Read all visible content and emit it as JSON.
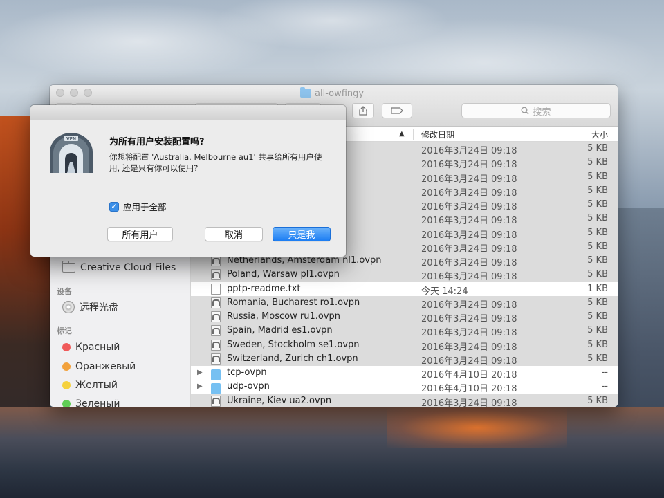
{
  "finder": {
    "title": "all-owfingy",
    "search_placeholder": "搜索",
    "columns": {
      "name": "",
      "date": "修改日期",
      "size": "大小"
    },
    "sidebar": {
      "creative_cloud": "Creative Cloud Files",
      "devices_header": "设备",
      "remote_disc": "远程光盘",
      "tags_header": "标记",
      "tags": [
        {
          "label": "Красный",
          "color": "#f05a5a"
        },
        {
          "label": "Оранжевый",
          "color": "#f2a13c"
        },
        {
          "label": "Желтый",
          "color": "#f5d13d"
        },
        {
          "label": "Зеленый",
          "color": "#5fce55"
        }
      ]
    },
    "rows": [
      {
        "name": "",
        "date": "2016年3月24日 09:18",
        "size": "5 KB",
        "type": "vpn",
        "sel": true
      },
      {
        "name": "",
        "date": "2016年3月24日 09:18",
        "size": "5 KB",
        "type": "vpn",
        "sel": true
      },
      {
        "name": "",
        "date": "2016年3月24日 09:18",
        "size": "5 KB",
        "type": "vpn",
        "sel": true
      },
      {
        "name": "",
        "date": "2016年3月24日 09:18",
        "size": "5 KB",
        "type": "vpn",
        "sel": true
      },
      {
        "name": "",
        "date": "2016年3月24日 09:18",
        "size": "5 KB",
        "type": "vpn",
        "sel": true
      },
      {
        "name": "",
        "date": "2016年3月24日 09:18",
        "size": "5 KB",
        "type": "vpn",
        "sel": true
      },
      {
        "name": "",
        "date": "2016年3月24日 09:18",
        "size": "5 KB",
        "type": "vpn",
        "sel": true
      },
      {
        "name": "",
        "date": "2016年3月24日 09:18",
        "size": "5 KB",
        "type": "vpn",
        "sel": true
      },
      {
        "name": "Netherlands, Amsterdam nl1.ovpn",
        "date": "2016年3月24日 09:18",
        "size": "5 KB",
        "type": "vpn",
        "sel": true
      },
      {
        "name": "Poland, Warsaw pl1.ovpn",
        "date": "2016年3月24日 09:18",
        "size": "5 KB",
        "type": "vpn",
        "sel": true
      },
      {
        "name": "pptp-readme.txt",
        "date": "今天 14:24",
        "size": "1 KB",
        "type": "doc",
        "sel": false
      },
      {
        "name": "Romania, Bucharest ro1.ovpn",
        "date": "2016年3月24日 09:18",
        "size": "5 KB",
        "type": "vpn",
        "sel": true
      },
      {
        "name": "Russia, Moscow ru1.ovpn",
        "date": "2016年3月24日 09:18",
        "size": "5 KB",
        "type": "vpn",
        "sel": true
      },
      {
        "name": "Spain, Madrid es1.ovpn",
        "date": "2016年3月24日 09:18",
        "size": "5 KB",
        "type": "vpn",
        "sel": true
      },
      {
        "name": "Sweden, Stockholm se1.ovpn",
        "date": "2016年3月24日 09:18",
        "size": "5 KB",
        "type": "vpn",
        "sel": true
      },
      {
        "name": "Switzerland, Zurich ch1.ovpn",
        "date": "2016年3月24日 09:18",
        "size": "5 KB",
        "type": "vpn",
        "sel": true
      },
      {
        "name": "tcp-ovpn",
        "date": "2016年4月10日 20:18",
        "size": "--",
        "type": "folder",
        "sel": false
      },
      {
        "name": "udp-ovpn",
        "date": "2016年4月10日 20:18",
        "size": "--",
        "type": "folder",
        "sel": false
      },
      {
        "name": "Ukraine, Kiev ua2.ovpn",
        "date": "2016年3月24日 09:18",
        "size": "5 KB",
        "type": "vpn",
        "sel": true
      }
    ]
  },
  "dialog": {
    "icon_label": "VPN",
    "title": "为所有用户安装配置吗?",
    "message": "你想将配置 'Australia, Melbourne au1' 共享给所有用户使用, 还是只有你可以使用?",
    "checkbox_label": "应用于全部",
    "checkbox_checked": true,
    "buttons": {
      "all_users": "所有用户",
      "cancel": "取消",
      "only_me": "只是我"
    }
  }
}
